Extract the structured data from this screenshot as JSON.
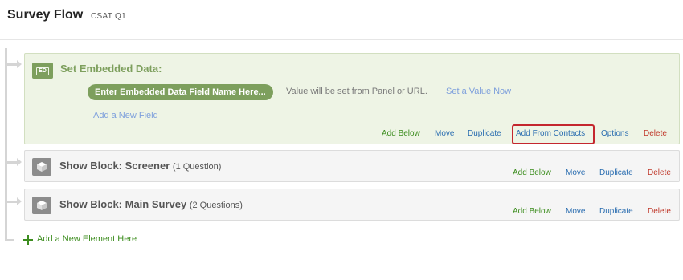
{
  "header": {
    "title": "Survey Flow",
    "survey_name": "CSAT Q1"
  },
  "embedded_data": {
    "icon_label": "ED",
    "title": "Set Embedded Data:",
    "field_placeholder": "Enter Embedded Data Field Name Here...",
    "value_text": "Value will be set from Panel or URL.",
    "set_value_link": "Set a Value Now",
    "add_field_link": "Add a New Field",
    "actions": {
      "add_below": "Add Below",
      "move": "Move",
      "duplicate": "Duplicate",
      "add_from_contacts": "Add From Contacts",
      "options": "Options",
      "delete": "Delete"
    }
  },
  "blocks": [
    {
      "title": "Show Block: Screener",
      "count": "(1 Question)",
      "actions": {
        "add_below": "Add Below",
        "move": "Move",
        "duplicate": "Duplicate",
        "delete": "Delete"
      }
    },
    {
      "title": "Show Block: Main Survey",
      "count": "(2 Questions)",
      "actions": {
        "add_below": "Add Below",
        "move": "Move",
        "duplicate": "Duplicate",
        "delete": "Delete"
      }
    }
  ],
  "add_element_label": "Add a New Element Here",
  "colors": {
    "embedded_green": "#7d9f5d",
    "link_blue": "#2a6db0",
    "action_green": "#3c8d1e",
    "delete_red": "#c0392b",
    "highlight_red": "#c4262e"
  },
  "icons": [
    "embedded-data-icon",
    "block-cube-icon",
    "plus-icon"
  ]
}
